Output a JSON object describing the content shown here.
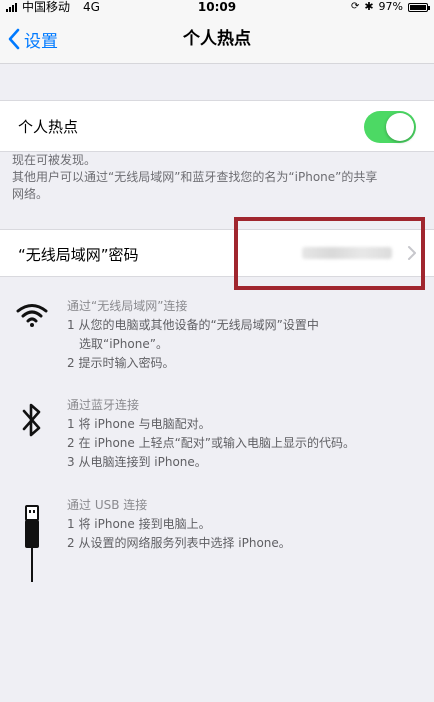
{
  "status_bar": {
    "carrier": "中国移动",
    "network": "4G",
    "time": "10:09",
    "battery_percent": "97%",
    "battery_level": 0.97
  },
  "nav": {
    "back_label": "设置",
    "title": "个人热点"
  },
  "hotspot": {
    "label": "个人热点",
    "enabled": true,
    "toggle_color": "#4cd964"
  },
  "discoverable": {
    "line1": "现在可被发现。",
    "line2": "其他用户可以通过“无线局域网”和蓝牙查找您的名为“iPhone”的共享",
    "line3": "网络。"
  },
  "wifi_password": {
    "label": "“无线局域网”密码"
  },
  "sections": {
    "wifi": {
      "icon": "wifi-icon",
      "title": "通过“无线局域网”连接",
      "step1a": "1 从您的电脑或其他设备的“无线局域网”设置中",
      "step1b": "选取“iPhone”。",
      "step2": "2 提示时输入密码。"
    },
    "bluetooth": {
      "icon": "bluetooth-icon",
      "title": "通过蓝牙连接",
      "step1": "1 将 iPhone 与电脑配对。",
      "step2": "2 在 iPhone 上轻点“配对”或输入电脑上显示的代码。",
      "step3": "3 从电脑连接到 iPhone。"
    },
    "usb": {
      "icon": "usb-cable-icon",
      "title": "通过 USB 连接",
      "step1": "1 将 iPhone 接到电脑上。",
      "step2": "2 从设置的网络服务列表中选择 iPhone。"
    }
  },
  "colors": {
    "accent": "#007aff",
    "highlight_border": "#a0262e",
    "background": "#efeff4"
  }
}
